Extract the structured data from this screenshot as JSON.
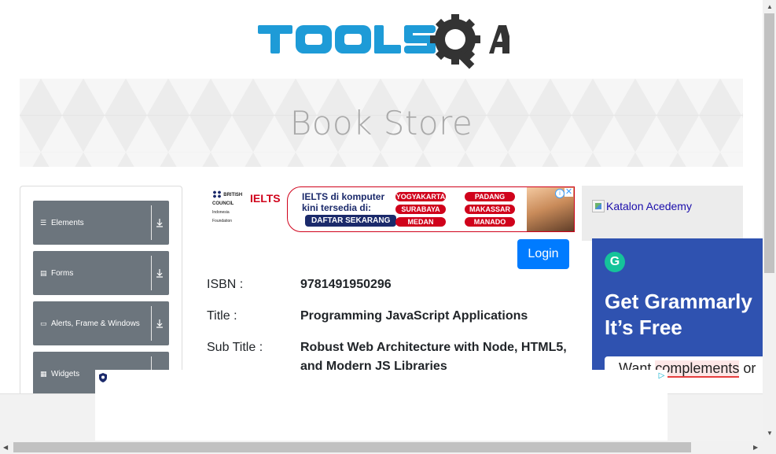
{
  "header": {
    "logo_text": "TOOLSQA"
  },
  "banner": {
    "title": "Book Store"
  },
  "sidebar": {
    "groups": [
      {
        "label": "Elements",
        "icon": "hamburger-icon"
      },
      {
        "label": "Forms",
        "icon": "form-icon"
      },
      {
        "label": "Alerts, Frame & Windows",
        "icon": "window-icon"
      },
      {
        "label": "Widgets",
        "icon": "grid-icon"
      }
    ]
  },
  "top_ad": {
    "brand": "BRITISH COUNCIL",
    "brand_sub": "Indonesia Foundation",
    "ielts": "IELTS",
    "headline_1": "IELTS di komputer",
    "headline_2": "kini tersedia di:",
    "cta": "DAFTAR SEKARANG",
    "cities": [
      "YOGYAKARTA",
      "PADANG",
      "SURABAYA",
      "MAKASSAR",
      "MEDAN",
      "MANADO"
    ]
  },
  "login": {
    "label": "Login"
  },
  "book": {
    "isbn_label": "ISBN :",
    "isbn_value": "9781491950296",
    "title_label": "Title :",
    "title_value": "Programming JavaScript Applications",
    "subtitle_label": "Sub Title :",
    "subtitle_value": "Robust Web Architecture with Node, HTML5, and Modern JS Libraries"
  },
  "right_ads": {
    "katalon_alt": "Katalon Acedemy",
    "grammarly_line1": "Get Grammarly",
    "grammarly_line2": "It’s Free",
    "grammarly_card_pre": "Want ",
    "grammarly_card_hl": "complements",
    "grammarly_card_post": " or",
    "grammarly_logo": "G"
  },
  "colors": {
    "primary": "#007bff",
    "menu": "#6c757d",
    "logo_blue": "#1e9bd7",
    "logo_dark": "#333333"
  }
}
